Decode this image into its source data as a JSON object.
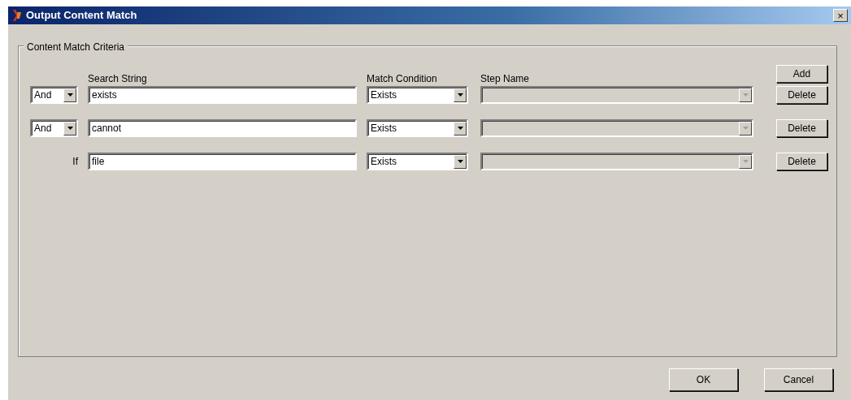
{
  "window": {
    "title": "Output Content Match",
    "close": "×"
  },
  "group": {
    "title": "Content Match Criteria"
  },
  "columns": [
    "Search String",
    "Match Condition",
    "Step Name"
  ],
  "add_button": "Add",
  "rows": [
    {
      "operator": {
        "kind": "select",
        "value": "And"
      },
      "search": "exists",
      "condition": "Exists",
      "step_disabled": true,
      "delete": "Delete"
    },
    {
      "operator": {
        "kind": "select",
        "value": "And"
      },
      "search": "cannot",
      "condition": "Exists",
      "step_disabled": true,
      "delete": "Delete"
    },
    {
      "operator": {
        "kind": "label",
        "value": "If"
      },
      "search": "file",
      "condition": "Exists",
      "step_disabled": true,
      "delete": "Delete"
    }
  ],
  "buttons": [
    "OK",
    "Cancel"
  ]
}
